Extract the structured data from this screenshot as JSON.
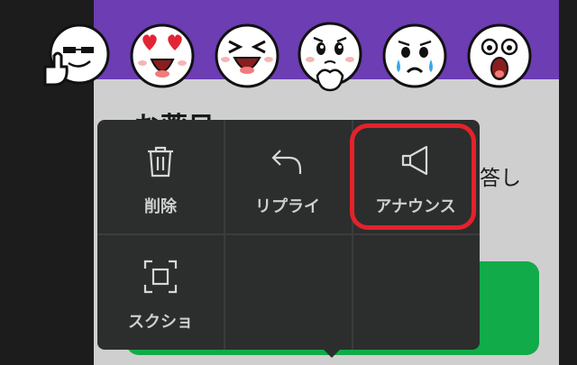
{
  "background": {
    "title": "お薬日",
    "side_text": "答し",
    "header_color": "#6c3db3",
    "button_color": "#11ab4a"
  },
  "stickers": [
    {
      "name": "sticker-thumbs-up"
    },
    {
      "name": "sticker-heart-eyes"
    },
    {
      "name": "sticker-laughing"
    },
    {
      "name": "sticker-pleading"
    },
    {
      "name": "sticker-crying"
    },
    {
      "name": "sticker-shocked"
    }
  ],
  "context_menu": {
    "delete_label": "削除",
    "reply_label": "リプライ",
    "announce_label": "アナウンス",
    "screenshot_label": "スクショ",
    "highlight_color": "#e4222b"
  }
}
